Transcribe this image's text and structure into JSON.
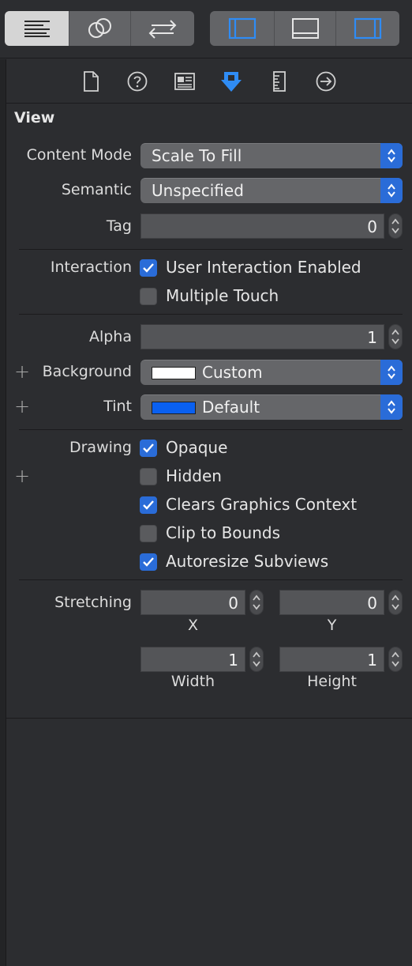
{
  "section_title": "View",
  "content_mode": {
    "label": "Content Mode",
    "value": "Scale To Fill"
  },
  "semantic": {
    "label": "Semantic",
    "value": "Unspecified"
  },
  "tag": {
    "label": "Tag",
    "value": "0"
  },
  "interaction": {
    "label": "Interaction",
    "options": [
      {
        "label": "User Interaction Enabled",
        "checked": true
      },
      {
        "label": "Multiple Touch",
        "checked": false
      }
    ]
  },
  "alpha": {
    "label": "Alpha",
    "value": "1"
  },
  "background": {
    "label": "Background",
    "value": "Custom",
    "color": "#ffffff"
  },
  "tint": {
    "label": "Tint",
    "value": "Default",
    "color": "#0a60f0"
  },
  "drawing": {
    "label": "Drawing",
    "options": [
      {
        "label": "Opaque",
        "checked": true
      },
      {
        "label": "Hidden",
        "checked": false
      },
      {
        "label": "Clears Graphics Context",
        "checked": true
      },
      {
        "label": "Clip to Bounds",
        "checked": false
      },
      {
        "label": "Autoresize Subviews",
        "checked": true
      }
    ]
  },
  "stretching": {
    "label": "Stretching",
    "x": {
      "label": "X",
      "value": "0"
    },
    "y": {
      "label": "Y",
      "value": "0"
    },
    "width": {
      "label": "Width",
      "value": "1"
    },
    "height": {
      "label": "Height",
      "value": "1"
    }
  },
  "icons": {
    "toolbar": [
      "standard-editor-icon",
      "assistant-editor-icon",
      "version-editor-icon",
      "left-panel-icon",
      "bottom-panel-icon",
      "right-panel-icon"
    ],
    "inspector_tabs": [
      "file-icon",
      "help-icon",
      "identity-icon",
      "attributes-icon",
      "size-icon",
      "connections-icon"
    ]
  },
  "colors": {
    "accent": "#2a6cd8",
    "panel_bg": "#2c2d30",
    "control_bg": "#656669"
  }
}
